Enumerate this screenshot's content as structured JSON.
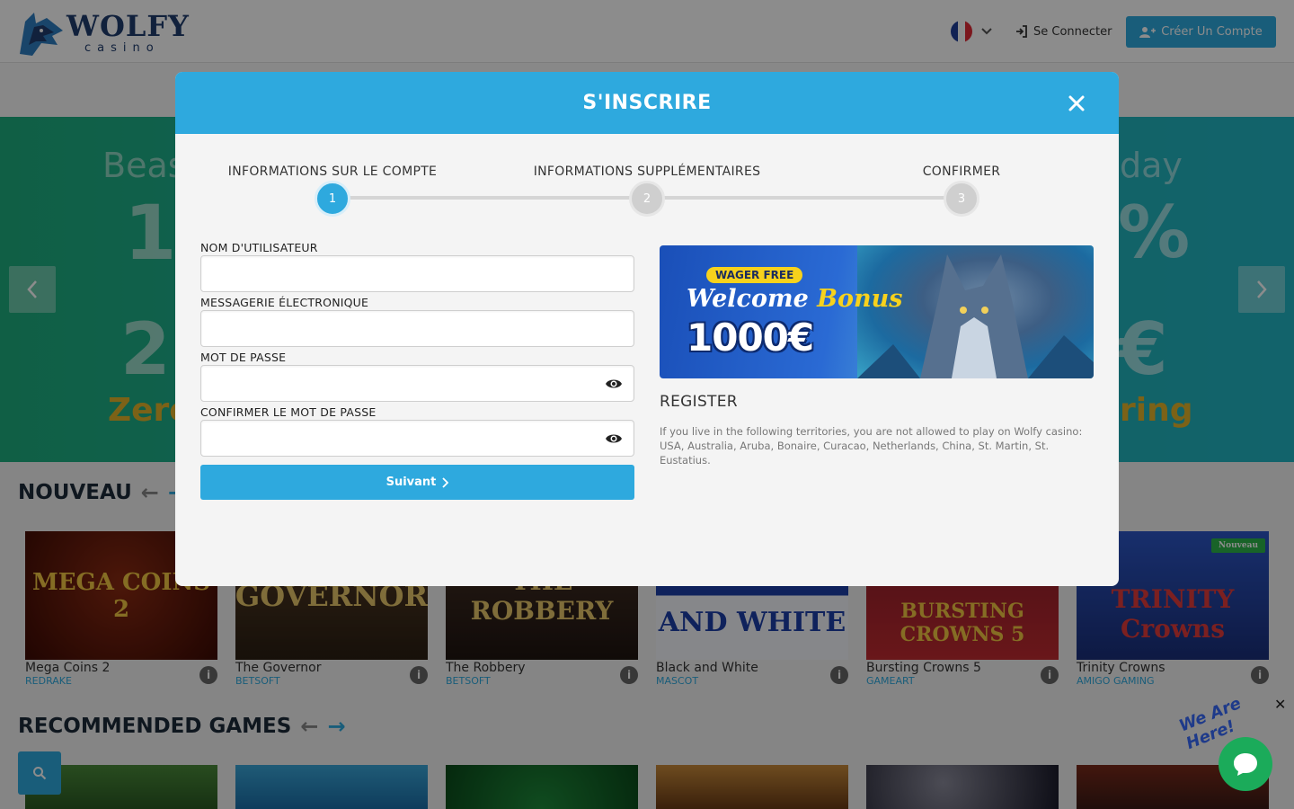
{
  "header": {
    "logo_word": "WOLFY",
    "logo_sub": "casino",
    "login_label": "Se Connecter",
    "create_label": "Créer Un Compte"
  },
  "hero": {
    "text_left_1": "Beas",
    "text_left_2": "1(",
    "text_left_3": "2",
    "text_left_4": "Zero",
    "text_right_1": "day",
    "text_right_2": "%",
    "text_right_3": "€",
    "text_right_4": "ring"
  },
  "sections": {
    "new_title": "NOUVEAU",
    "recommended_title": "RECOMMENDED GAMES"
  },
  "games": [
    {
      "name": "Mega Coins 2",
      "provider": "REDRAKE",
      "thumb": "MEGA COINS 2"
    },
    {
      "name": "The Governor",
      "provider": "BETSOFT",
      "thumb": "GOVERNOR"
    },
    {
      "name": "The Robbery",
      "provider": "BETSOFT",
      "thumb": "THE ROBBERY"
    },
    {
      "name": "Black and White",
      "provider": "MASCOT",
      "thumb": "AND WHITE"
    },
    {
      "name": "Bursting Crowns 5",
      "provider": "GAMEART",
      "thumb": "BURSTING CROWNS 5"
    },
    {
      "name": "Trinity Crowns",
      "provider": "AMIGO GAMING",
      "thumb": "TRINITY Crowns",
      "badge": "Nouveau"
    }
  ],
  "chat": {
    "tagline": "We Are Here!"
  },
  "modal": {
    "title": "S'INSCRIRE",
    "steps": [
      {
        "label": "INFORMATIONS SUR LE COMPTE",
        "number": "1"
      },
      {
        "label": "INFORMATIONS SUPPLÉMENTAIRES",
        "number": "2"
      },
      {
        "label": "CONFIRMER",
        "number": "3"
      }
    ],
    "fields": {
      "username_label": "NOM D'UTILISATEUR",
      "email_label": "MESSAGERIE ÉLECTRONIQUE",
      "password_label": "MOT DE PASSE",
      "confirm_label": "CONFIRMER LE MOT DE PASSE"
    },
    "next_label": "Suivant",
    "promo": {
      "wager": "WAGER FREE",
      "welcome": "Welcome",
      "bonus": "Bonus",
      "amount": "1000€"
    },
    "register_title": "REGISTER",
    "register_text": "If you live in the following territories, you are not allowed to play on Wolfy casino: USA, Australia, Aruba, Bonaire, Curacao, Netherlands, China, St. Martin, St. Eustatius."
  },
  "colors": {
    "accent": "#2ea9de",
    "chat": "#1bab5a",
    "badge": "#2db54a"
  }
}
